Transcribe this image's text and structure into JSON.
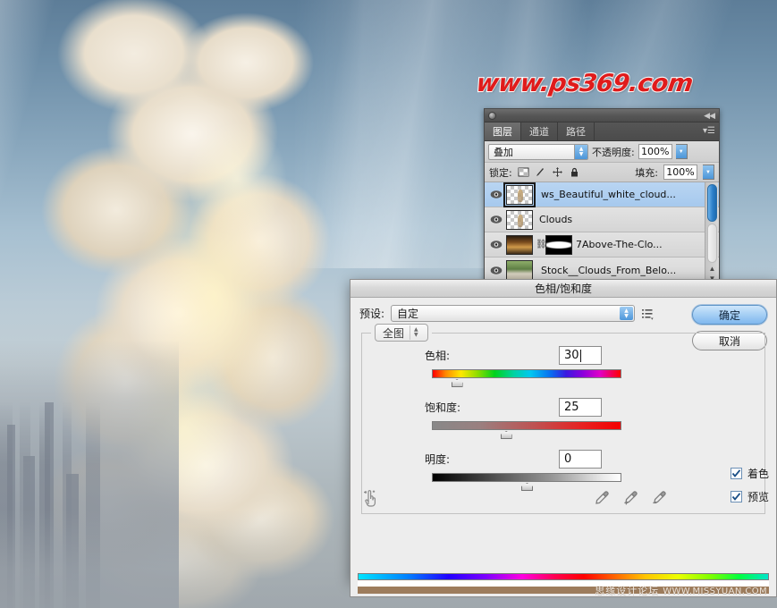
{
  "watermark": {
    "text": "www.ps369.com",
    "color": "#e01b1b"
  },
  "layers_panel": {
    "collapse_icon": "collapse-arrows-icon",
    "tabs": [
      {
        "label": "图层",
        "active": true
      },
      {
        "label": "通道",
        "active": false
      },
      {
        "label": "路径",
        "active": false
      }
    ],
    "menu_icon": "panel-menu-icon",
    "blend_mode": "叠加",
    "opacity_label": "不透明度:",
    "opacity_value": "100%",
    "lock_label": "锁定:",
    "lock_icons": [
      "lock-transparent-icon",
      "lock-image-icon",
      "lock-position-icon",
      "lock-all-icon"
    ],
    "fill_label": "填充:",
    "fill_value": "100%",
    "layers": [
      {
        "name": "ws_Beautiful_white_cloud...",
        "selected": true,
        "visible": true,
        "kind": "transparent"
      },
      {
        "name": "Clouds",
        "selected": false,
        "visible": true,
        "kind": "transparent"
      },
      {
        "name": "7Above-The-Clo...",
        "selected": false,
        "visible": true,
        "kind": "photo-mask"
      },
      {
        "name": "Stock__Clouds_From_Belo...",
        "selected": false,
        "visible": true,
        "kind": "photo"
      }
    ]
  },
  "dialog": {
    "title": "色相/饱和度",
    "preset_label": "预设:",
    "preset_value": "自定",
    "preset_menu_icon": "preset-menu-icon",
    "ok_button": "确定",
    "cancel_button": "取消",
    "range_select": "全图",
    "sliders": [
      {
        "label": "色相:",
        "value": "30",
        "track": "hue",
        "thumb_pct": 13,
        "caret": true
      },
      {
        "label": "饱和度:",
        "value": "25",
        "track": "sat",
        "thumb_pct": 39,
        "caret": false
      },
      {
        "label": "明度:",
        "value": "0",
        "track": "light",
        "thumb_pct": 50,
        "caret": false
      }
    ],
    "hand_tool_icon": "on-image-adjust-hand-icon",
    "droppers": [
      "eyedropper-icon",
      "eyedropper-add-icon",
      "eyedropper-subtract-icon"
    ],
    "checkboxes": [
      {
        "label": "着色",
        "checked": true
      },
      {
        "label": "预览",
        "checked": true
      }
    ]
  },
  "footer": {
    "site_cn": "思缘设计论坛",
    "site_url": "WWW.MISSYUAN.COM"
  }
}
